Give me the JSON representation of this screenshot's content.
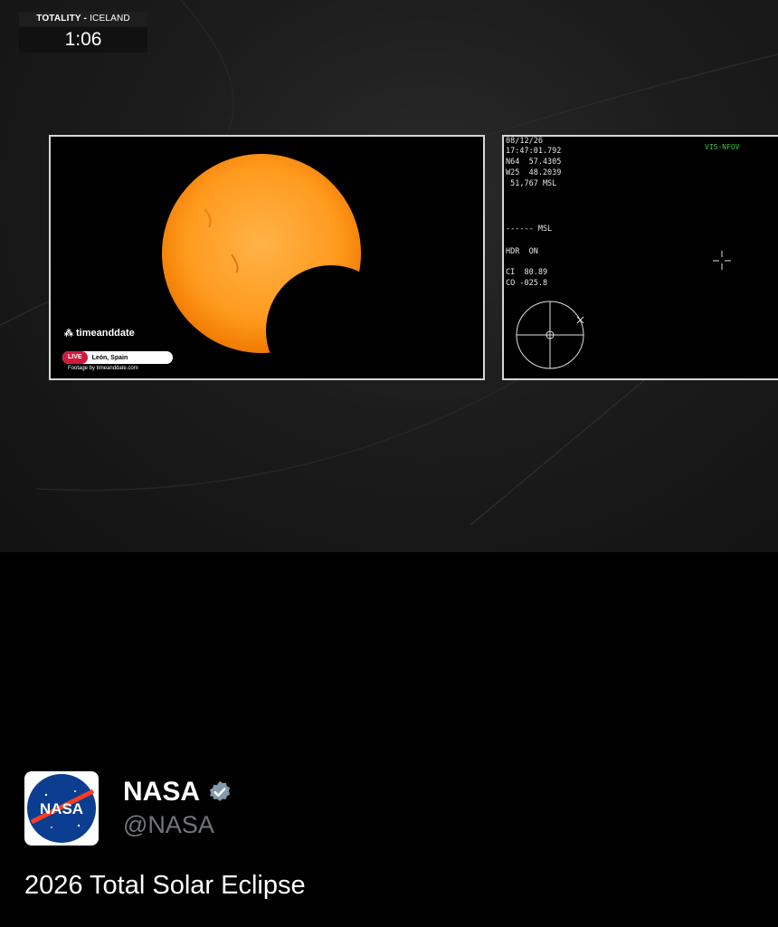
{
  "video": {
    "totality_label": "TOTALITY -",
    "totality_region": "ICELAND",
    "countdown": "1:06",
    "left_feed": {
      "brand": "timeanddate",
      "live_label": "LIVE",
      "location": "León, Spain",
      "footage_credit": "Footage by timeanddate.com"
    },
    "right_feed": {
      "date": "08/12/26",
      "time": "17:47:01.792",
      "lat": "N64  57.4305",
      "lon": "W25  48.2039",
      "altitude": " 51,767 MSL",
      "msl_line": "------ MSL",
      "hdr": "HDR  ON",
      "ci": "CI  80.89",
      "co": "CO -025.8",
      "mode": "VIS-NFOV"
    }
  },
  "post": {
    "avatar_icon": "nasa-meatball-logo",
    "avatar_text": "NASA",
    "name": "NASA",
    "verified_icon": "verified-badge-icon",
    "handle": "@NASA",
    "text": "2026 Total Solar Eclipse"
  }
}
